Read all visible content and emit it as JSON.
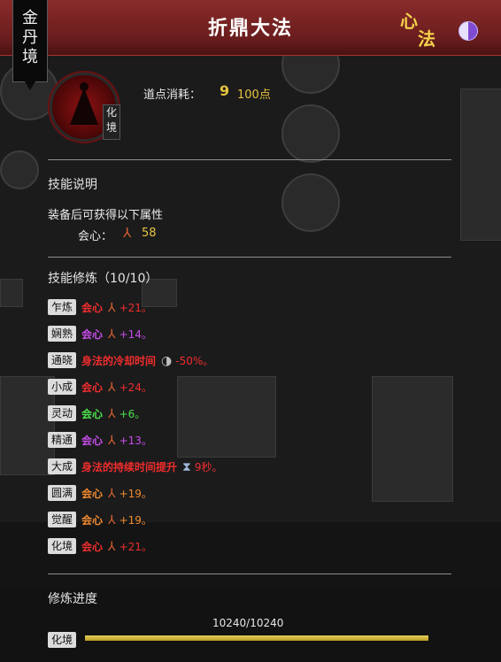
{
  "header": {
    "title": "折鼎大法",
    "realm": "金丹境",
    "logo_text_1": "心",
    "logo_text_2": "法",
    "yinyang_icon": "yinyang-icon"
  },
  "skill": {
    "level_badge": "化境",
    "cost_label": "道点消耗：",
    "cost_icon": "9",
    "cost_value": "100点"
  },
  "description": {
    "title": "技能说明",
    "text": "装备后可获得以下属性",
    "bonus_label": "会心：",
    "bonus_icon": "crit-icon",
    "bonus_value": "58"
  },
  "training": {
    "title": "技能修炼（10/10）",
    "rows": [
      {
        "tag": "乍炼",
        "stat": "会心",
        "value": "+21。",
        "color": "#f02d2d",
        "icon": "crit-icon"
      },
      {
        "tag": "娴熟",
        "stat": "会心",
        "value": "+14。",
        "color": "#c64de8",
        "icon": "crit-icon"
      },
      {
        "tag": "通晓",
        "stat": "身法的冷却时间",
        "value": "-50%。",
        "color": "#f02d2d",
        "icon": "cooldown-icon"
      },
      {
        "tag": "小成",
        "stat": "会心",
        "value": "+24。",
        "color": "#f02d2d",
        "icon": "crit-icon"
      },
      {
        "tag": "灵动",
        "stat": "会心",
        "value": "+6。",
        "color": "#4de04d",
        "icon": "crit-icon"
      },
      {
        "tag": "精通",
        "stat": "会心",
        "value": "+13。",
        "color": "#c64de8",
        "icon": "crit-icon"
      },
      {
        "tag": "大成",
        "stat": "身法的持续时间提升",
        "value": "9秒。",
        "color": "#f02d2d",
        "icon": "hourglass-icon"
      },
      {
        "tag": "圆满",
        "stat": "会心",
        "value": "+19。",
        "color": "#f08a2f",
        "icon": "crit-icon"
      },
      {
        "tag": "觉醒",
        "stat": "会心",
        "value": "+19。",
        "color": "#f08a2f",
        "icon": "crit-icon"
      },
      {
        "tag": "化境",
        "stat": "会心",
        "value": "+21。",
        "color": "#f02d2d",
        "icon": "crit-icon"
      }
    ]
  },
  "progress": {
    "title": "修炼进度",
    "text": "10240/10240",
    "tag": "化境",
    "fraction": 1.0
  }
}
